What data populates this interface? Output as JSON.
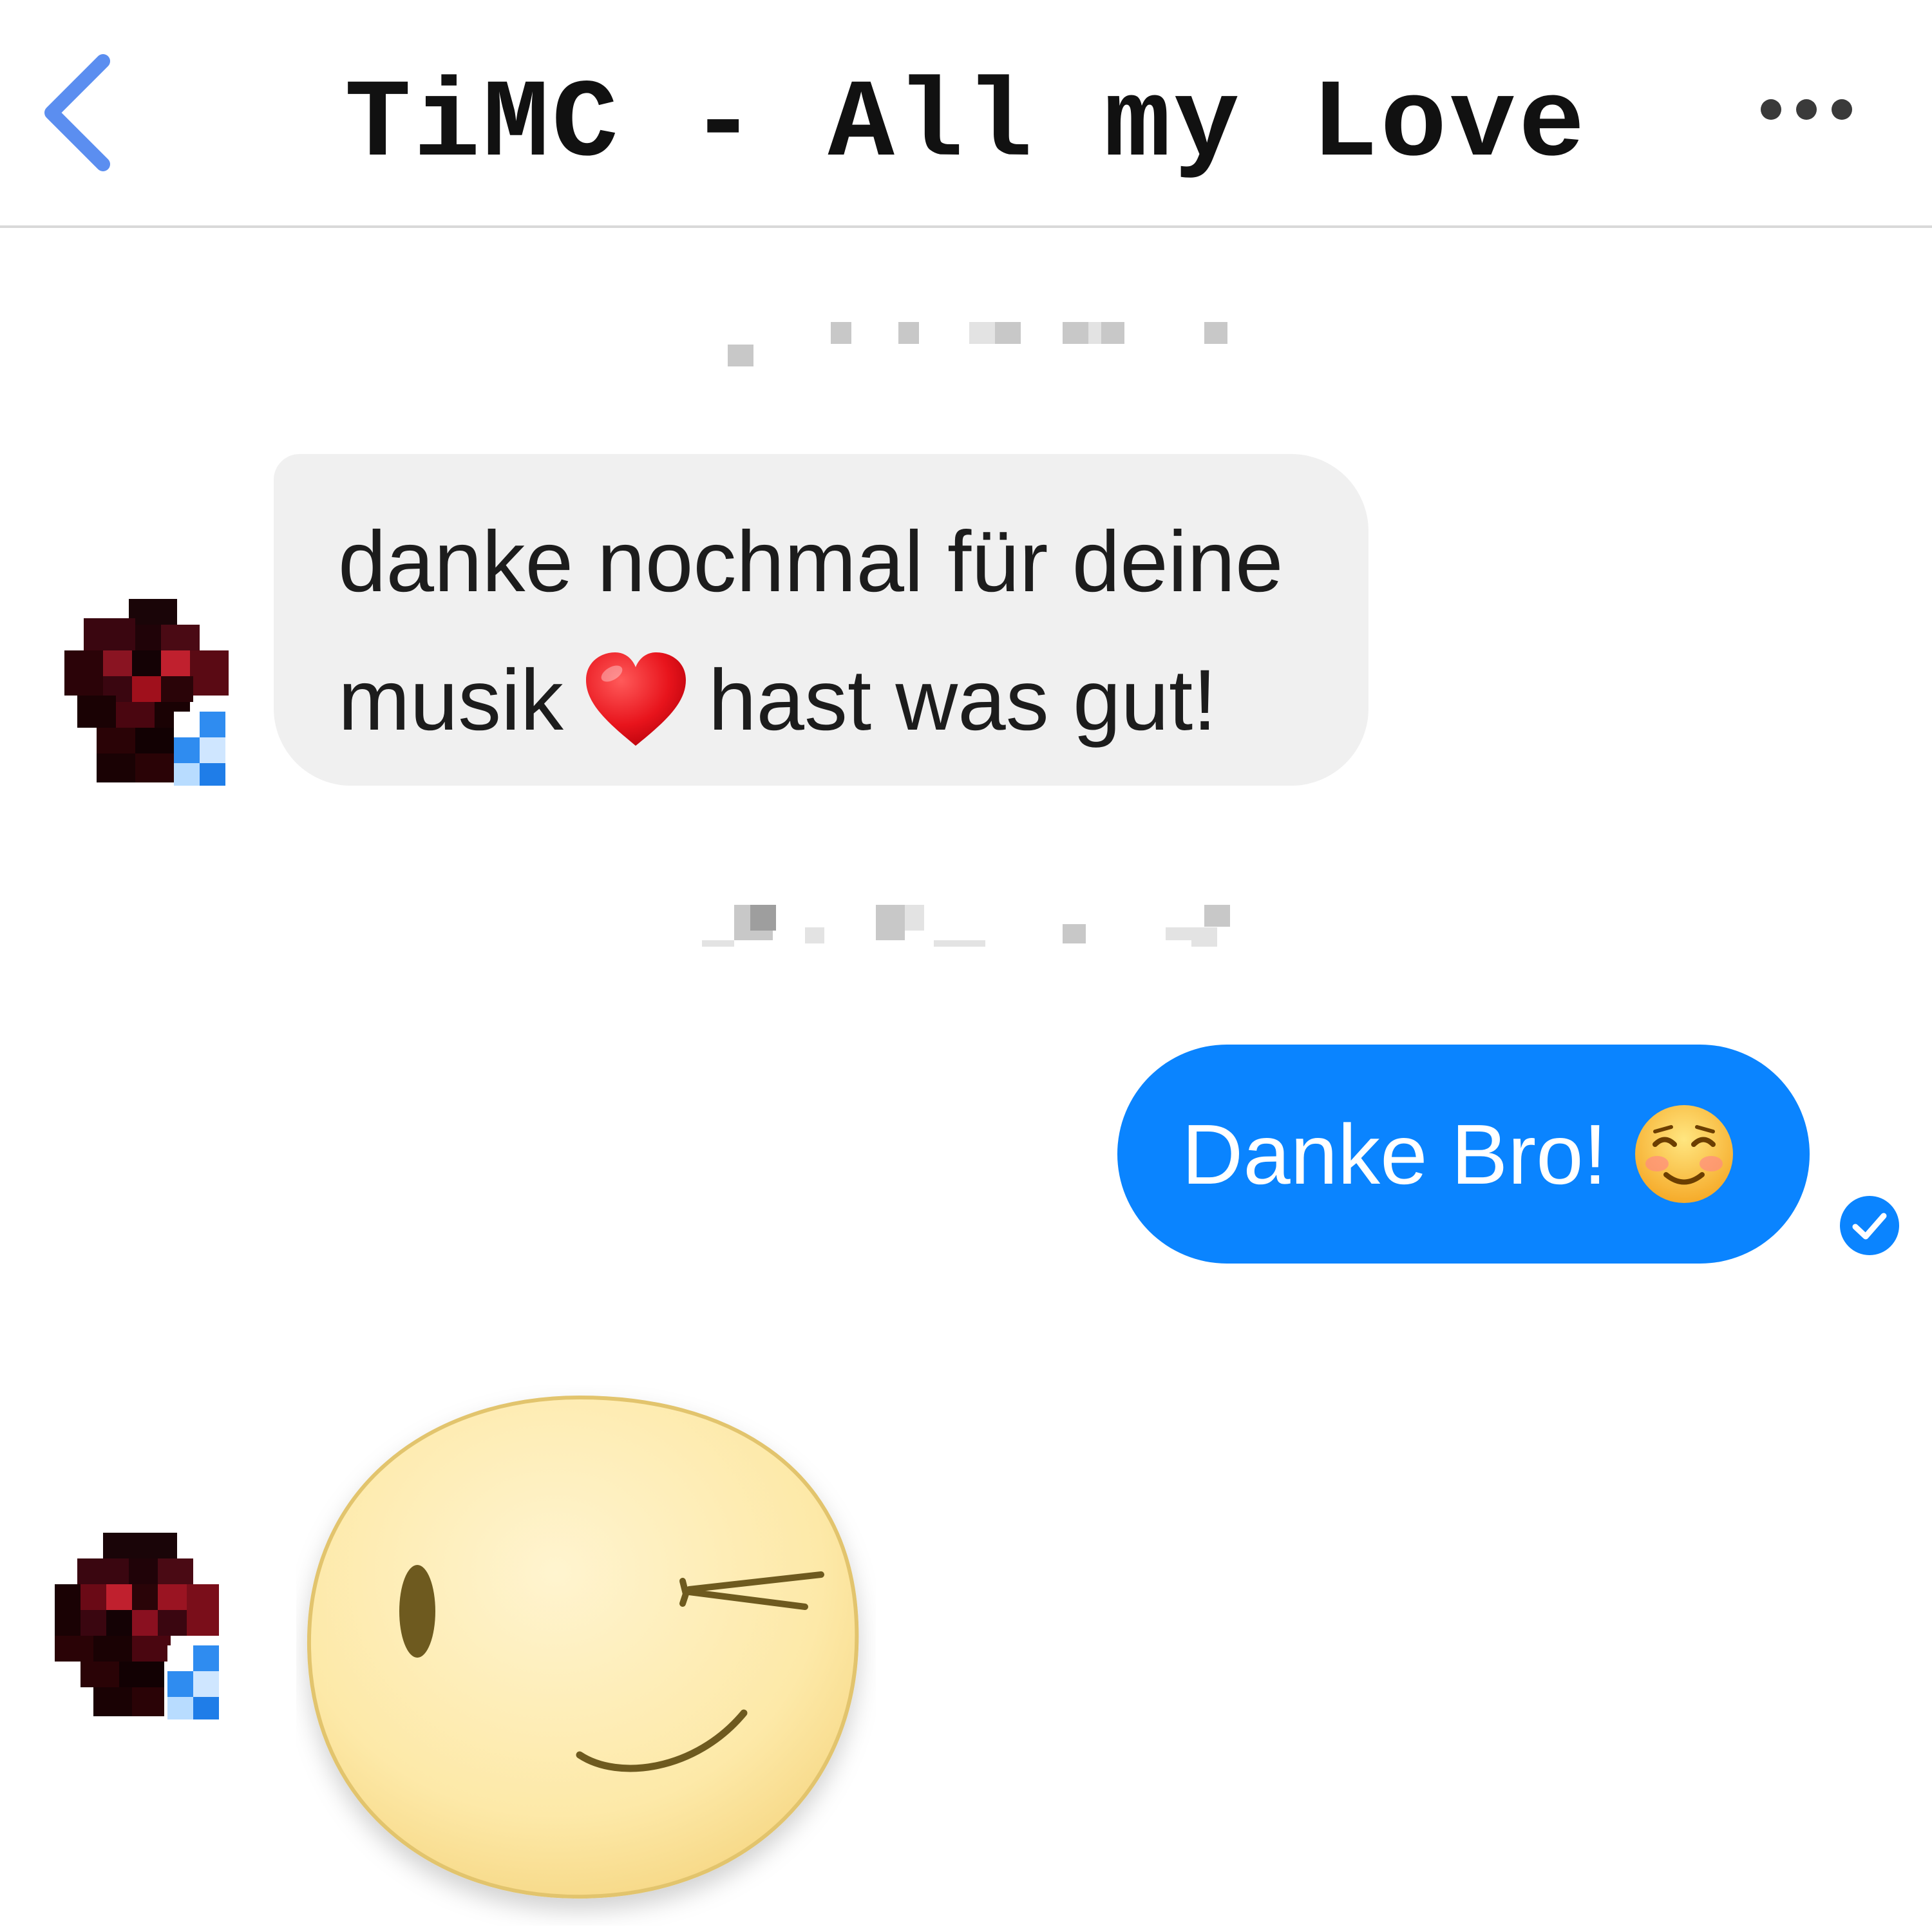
{
  "header": {
    "title": "TiMC - All my Love",
    "back_icon": "chevron-left-icon",
    "more_icon": "more-horizontal-icon"
  },
  "messages": [
    {
      "direction": "incoming",
      "line1": "danke nochmal für deine",
      "line2_before": "musik",
      "line2_emoji": "red-heart-emoji",
      "line2_after": "hast was gut!"
    },
    {
      "direction": "outgoing",
      "text": "Danke Bro!",
      "emoji": "smiling-face-emoji",
      "status_icon": "read-check-icon"
    },
    {
      "direction": "incoming",
      "sticker": "wink-face-sticker"
    }
  ],
  "colors": {
    "accent": "#0a84ff",
    "back_chevron": "#5b8ef0",
    "incoming_bubble": "#f0f0f0",
    "outgoing_bubble": "#0a84ff"
  }
}
